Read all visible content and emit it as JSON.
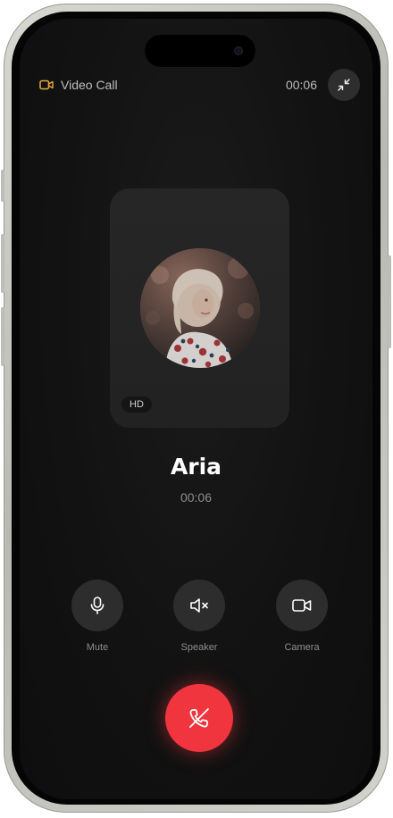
{
  "header": {
    "call_type_label": "Video Call",
    "timer": "00:06",
    "call_type_icon": "video-camera-icon",
    "minimize_icon": "minimize-arrows-icon"
  },
  "video_card": {
    "badge": "HD",
    "avatar_icon": "caller-avatar-photo"
  },
  "caller": {
    "name": "Aria",
    "duration": "00:06"
  },
  "controls": [
    {
      "label": "Mute",
      "icon": "microphone-icon"
    },
    {
      "label": "Speaker",
      "icon": "speaker-muted-icon"
    },
    {
      "label": "Camera",
      "icon": "video-camera-icon"
    }
  ],
  "end_call": {
    "icon": "phone-hangup-icon",
    "color": "#f0353f"
  },
  "colors": {
    "background": "#121212",
    "accent_icon": "#e6a93c",
    "end_call": "#f0353f"
  }
}
